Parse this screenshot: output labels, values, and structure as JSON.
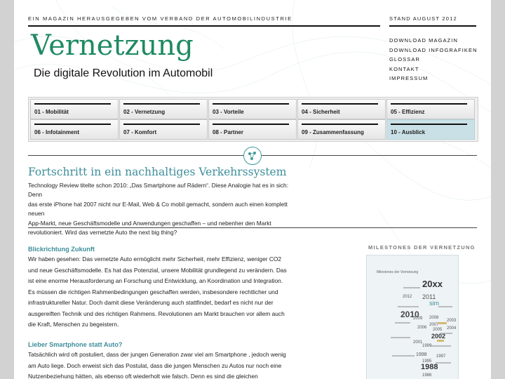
{
  "header": {
    "tagline": "EIN MAGAZIN HERAUSGEGEBEN VOM VERBAND DER AUTOMOBILINDUSTRIE",
    "stand": "STAND AUGUST 2012",
    "title": "Vernetzung",
    "subtitle": "Die digitale Revolution im Automobil"
  },
  "right_nav": [
    "DOWNLOAD MAGAZIN",
    "DOWNLOAD INFOGRAFIKEN",
    "GLOSSAR",
    "KONTAKT",
    "IMPRESSUM"
  ],
  "menu": [
    {
      "label": "01 - Mobilität",
      "active": false
    },
    {
      "label": "02 - Vernetzung",
      "active": false
    },
    {
      "label": "03 - Vorteile",
      "active": false
    },
    {
      "label": "04 - Sicherheit",
      "active": false
    },
    {
      "label": "05 - Effizienz",
      "active": false
    },
    {
      "label": "06 - Infotainment",
      "active": false
    },
    {
      "label": "07 - Komfort",
      "active": false
    },
    {
      "label": "08 - Partner",
      "active": false
    },
    {
      "label": "09 - Zusammenfassung",
      "active": false
    },
    {
      "label": "10 - Ausblick",
      "active": true
    }
  ],
  "section": {
    "heading": "Fortschritt in ein nachhaltiges Verkehrssystem",
    "intro_l1": "Technology Review titelte schon 2010: „Das Smartphone auf Rädern“. Diese Analogie hat es in sich: Denn",
    "intro_l2": "das erste iPhone hat 2007 nicht nur E-Mail, Web & Co mobil gemacht, sondern auch einen komplett neuen",
    "intro_l3": "App-Markt, neue Geschäftsmodelle und Anwendungen geschaffen – und nebenher den Markt",
    "intro_l4": "revolutioniert. Wird das vernetzte Auto the next big thing?"
  },
  "article1": {
    "heading": "Blickrichtung Zukunft",
    "l1": "Wir haben gesehen: Das vernetzte Auto ermöglicht mehr Sicherheit, mehr Effizienz, weniger CO2",
    "l2": "und neue Geschäftsmodelle. Es hat das Potenzial, unsere Mobilität grundlegend zu verändern. Das",
    "l3": "ist eine enorme Herausforderung an Forschung und Entwicklung, an Koordination und Integration.",
    "l4": "Es müssen die richtigen Rahmenbedingungen geschaffen werden, insbesondere rechtlicher und",
    "l5": "infrastruktureller Natur. Doch damit diese Veränderung auch stattfindet, bedarf es nicht nur der",
    "l6": "ausgereiften Technik und des richtigen Rahmens. Revolutionen am Markt brauchen vor allem auch",
    "l7": "die Kraft, Menschen zu begeistern."
  },
  "article2": {
    "heading": "Lieber Smartphone statt Auto?",
    "l1": "Tatsächlich wird oft postuliert, dass der jungen Generation zwar viel am Smartphone , jedoch wenig",
    "l2": "am Auto liege. Doch erweist sich das Postulat, dass die jungen Menschen zu Autos nur noch eine",
    "l3": "Nutzenbeziehung hätten, als ebenso oft wiederholt wie falsch. Denn es sind die gleichen"
  },
  "milestones": {
    "title": "MILESTONES DER VERNETZUNG",
    "card_title": "Milestones der Vernetzung",
    "years": [
      "20xx",
      "2012",
      "2011",
      "sim",
      "2010",
      "2009",
      "2008",
      "2007",
      "2006",
      "2005",
      "2004",
      "2003",
      "2002",
      "2001",
      "1999",
      "1998",
      "1997",
      "1995",
      "1988",
      "1986"
    ]
  },
  "colors": {
    "accent": "#1f8a63",
    "heading": "#3d8e9a",
    "active_tab": "#c9e1e6"
  }
}
